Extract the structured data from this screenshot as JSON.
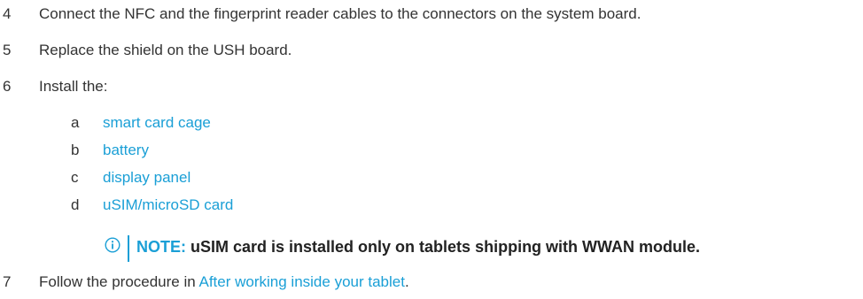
{
  "steps": [
    {
      "number": "4",
      "text": "Connect the NFC and the fingerprint reader cables to the connectors on the system board."
    },
    {
      "number": "5",
      "text": "Replace the shield on the USH board."
    },
    {
      "number": "6",
      "text": "Install the:"
    },
    {
      "number": "7",
      "text_before": "Follow the procedure in ",
      "link": "After working inside your tablet",
      "text_after": "."
    }
  ],
  "substeps": [
    {
      "letter": "a",
      "link": "smart card cage"
    },
    {
      "letter": "b",
      "link": "battery"
    },
    {
      "letter": "c",
      "link": "display panel"
    },
    {
      "letter": "d",
      "link": "uSIM/microSD card"
    }
  ],
  "note": {
    "label": "NOTE:",
    "text": " uSIM card is installed only on tablets shipping with WWAN module.",
    "icon": "info-icon"
  },
  "colors": {
    "link": "#1a9fd6",
    "text": "#333333"
  }
}
